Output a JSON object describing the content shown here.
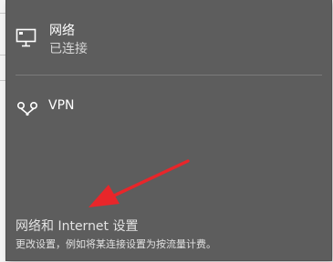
{
  "network": {
    "title": "网络",
    "status": "已连接",
    "icon": "wired-network-icon"
  },
  "vpn": {
    "label": "VPN",
    "icon": "vpn-icon"
  },
  "settings": {
    "link_label": "网络和 Internet 设置",
    "description": "更改设置，例如将某连接设置为按流量计费。"
  },
  "annotation": {
    "arrow_color": "#e8262a"
  },
  "colors": {
    "flyout_background": "#5d5d5d",
    "text_primary": "#ffffff",
    "text_secondary": "#d6d6d6"
  }
}
